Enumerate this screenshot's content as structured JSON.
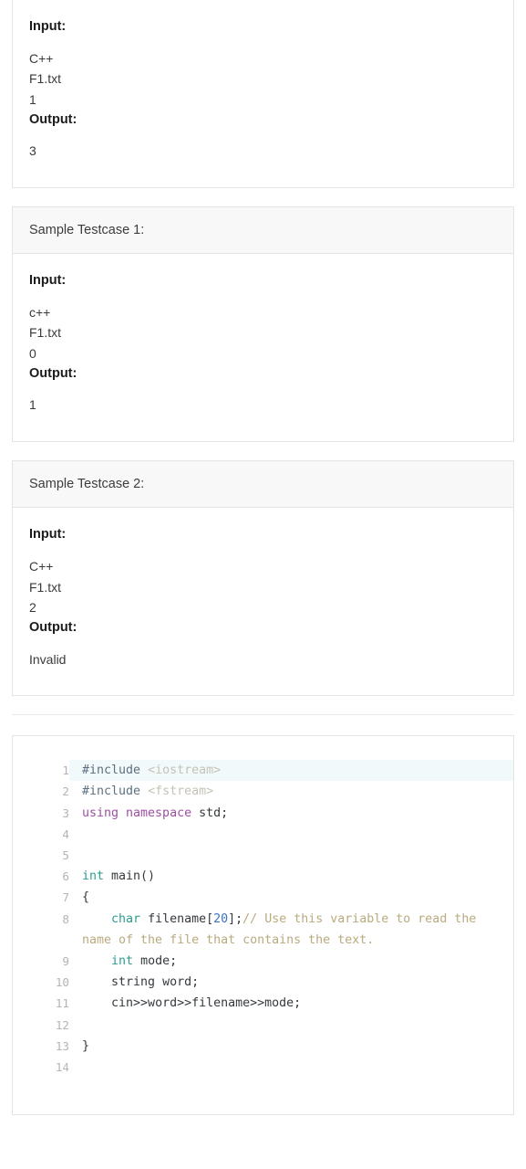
{
  "testcases": [
    {
      "header": null,
      "input_label": "Input:",
      "input_value": "C++\nF1.txt\n1",
      "output_label": "Output:",
      "output_value": "3"
    },
    {
      "header": "Sample Testcase 1:",
      "input_label": "Input:",
      "input_value": "c++\nF1.txt\n0",
      "output_label": "Output:",
      "output_value": "1"
    },
    {
      "header": "Sample Testcase 2:",
      "input_label": "Input:",
      "input_value": "C++\nF1.txt\n2",
      "output_label": "Output:",
      "output_value": "Invalid"
    }
  ],
  "editor": {
    "language": "cpp",
    "active_line": 1,
    "lines": [
      {
        "n": "1",
        "tokens": [
          {
            "t": "#include ",
            "c": "t-pre"
          },
          {
            "t": "<iostream>",
            "c": "t-inc"
          }
        ]
      },
      {
        "n": "2",
        "tokens": [
          {
            "t": "#include ",
            "c": "t-pre"
          },
          {
            "t": "<fstream>",
            "c": "t-inc"
          }
        ]
      },
      {
        "n": "3",
        "tokens": [
          {
            "t": "using namespace ",
            "c": "t-kw"
          },
          {
            "t": "std;",
            "c": "t-ident"
          }
        ]
      },
      {
        "n": "4",
        "tokens": []
      },
      {
        "n": "5",
        "tokens": []
      },
      {
        "n": "6",
        "tokens": [
          {
            "t": "int ",
            "c": "t-type"
          },
          {
            "t": "main()",
            "c": "t-ident"
          }
        ]
      },
      {
        "n": "7",
        "tokens": [
          {
            "t": "{",
            "c": "t-punct"
          }
        ]
      },
      {
        "n": "8",
        "tokens": [
          {
            "t": "    ",
            "c": "t-plain"
          },
          {
            "t": "char ",
            "c": "t-type"
          },
          {
            "t": "filename",
            "c": "t-ident"
          },
          {
            "t": "[",
            "c": "t-punct"
          },
          {
            "t": "20",
            "c": "t-num"
          },
          {
            "t": "]",
            "c": "t-punct"
          },
          {
            "t": ";",
            "c": "t-punct"
          },
          {
            "t": "// Use this variable to read the name of the file that contains the text.",
            "c": "t-cmt"
          }
        ]
      },
      {
        "n": "9",
        "tokens": [
          {
            "t": "    ",
            "c": "t-plain"
          },
          {
            "t": "int ",
            "c": "t-type"
          },
          {
            "t": "mode;",
            "c": "t-ident"
          }
        ]
      },
      {
        "n": "10",
        "tokens": [
          {
            "t": "    ",
            "c": "t-plain"
          },
          {
            "t": "string word;",
            "c": "t-ident"
          }
        ]
      },
      {
        "n": "11",
        "tokens": [
          {
            "t": "    ",
            "c": "t-plain"
          },
          {
            "t": "cin>>word>>filename>>mode;",
            "c": "t-ident"
          }
        ]
      },
      {
        "n": "12",
        "tokens": []
      },
      {
        "n": "13",
        "tokens": [
          {
            "t": "}",
            "c": "t-punct"
          }
        ]
      },
      {
        "n": "14",
        "tokens": []
      }
    ]
  },
  "colors": {
    "card_border": "#e4e4e4",
    "header_bg": "#f8f8f8",
    "active_line_bg": "#f2f9fb",
    "gutter_text": "#b4b4b4",
    "comment": "#b9aa7e",
    "keyword": "#9d4fa0",
    "type": "#2a9d8f",
    "number": "#3a72c8"
  }
}
